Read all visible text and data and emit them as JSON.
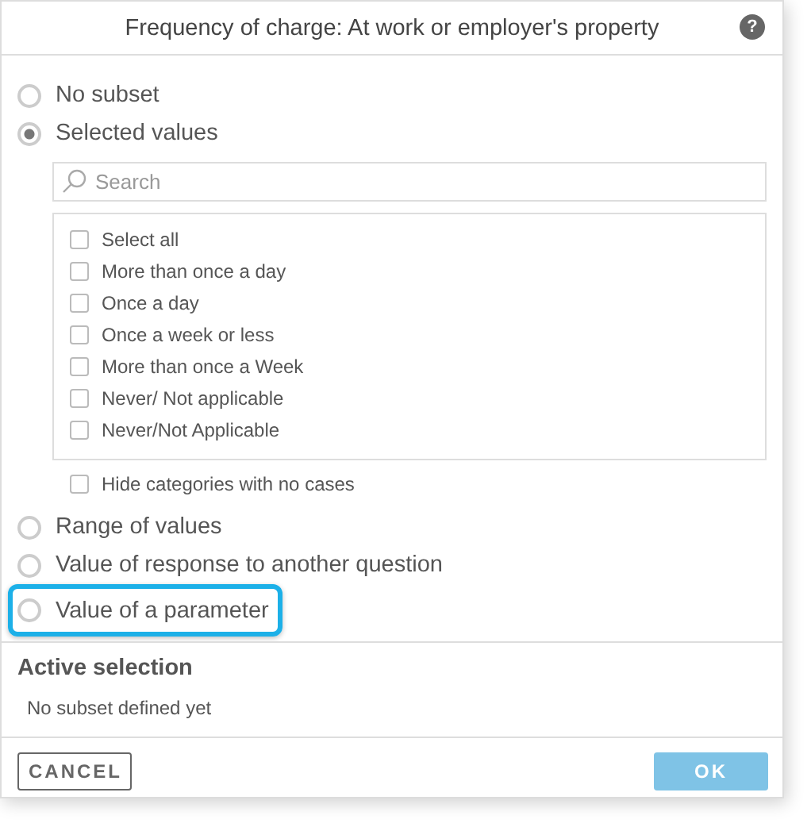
{
  "dialog": {
    "title": "Frequency of charge: At work or employer's property",
    "help_label": "?"
  },
  "options_top": [
    {
      "label": "No subset",
      "selected": false,
      "highlighted": false
    },
    {
      "label": "Selected values",
      "selected": true,
      "highlighted": false
    }
  ],
  "search": {
    "placeholder": "Search"
  },
  "values": [
    {
      "label": "Select all",
      "checked": false
    },
    {
      "label": "More than once a day",
      "checked": false
    },
    {
      "label": "Once a day",
      "checked": false
    },
    {
      "label": "Once a week or less",
      "checked": false
    },
    {
      "label": "More than once a Week",
      "checked": false
    },
    {
      "label": "Never/ Not applicable",
      "checked": false
    },
    {
      "label": "Never/Not Applicable",
      "checked": false
    }
  ],
  "hide_empty": {
    "label": "Hide categories with no cases",
    "checked": false
  },
  "options_bottom": [
    {
      "label": "Range of values",
      "selected": false,
      "highlighted": false
    },
    {
      "label": "Value of response to another question",
      "selected": false,
      "highlighted": false
    },
    {
      "label": "Value of a parameter",
      "selected": false,
      "highlighted": true
    }
  ],
  "active_selection": {
    "heading": "Active selection",
    "text": "No subset defined yet"
  },
  "buttons": [
    {
      "label": "CANCEL",
      "kind": "secondary",
      "disabled": false
    },
    {
      "label": "OK",
      "kind": "primary",
      "disabled": true
    }
  ]
}
